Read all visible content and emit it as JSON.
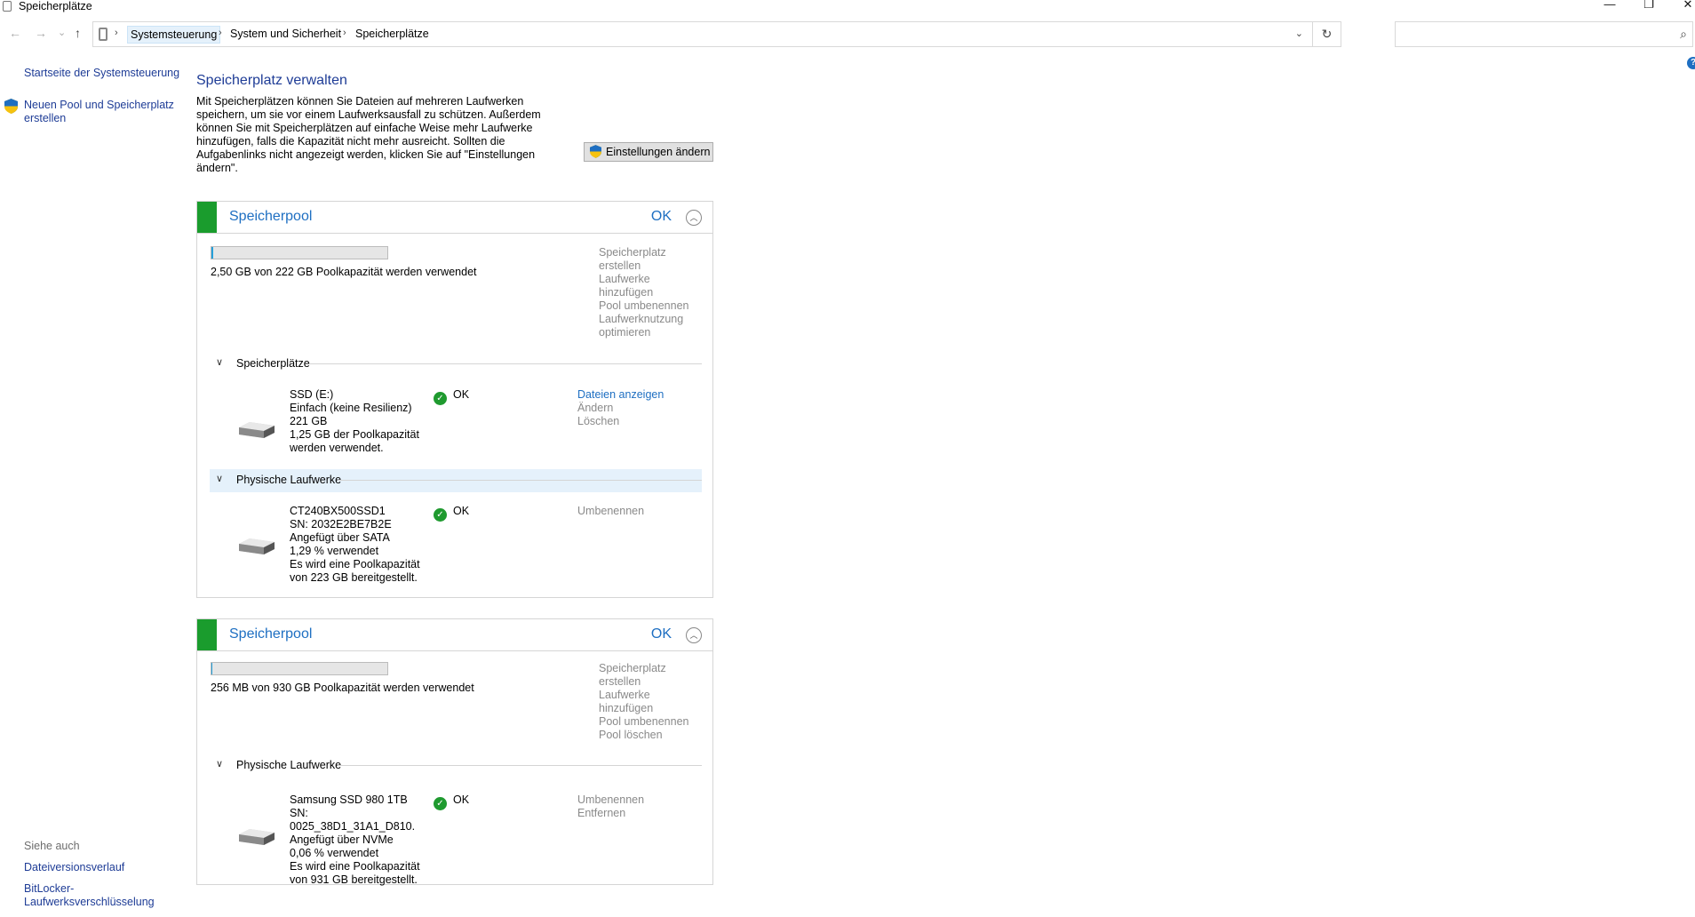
{
  "window": {
    "title": "Speicherplätze",
    "minimize": "—",
    "restore": "❐",
    "close": "✕"
  },
  "nav": {
    "back": "←",
    "forward": "→",
    "recent": "⌄",
    "up": "↑"
  },
  "address": {
    "crumbs": [
      "Systemsteuerung",
      "System und Sicherheit",
      "Speicherplätze"
    ],
    "separator": "›",
    "dropdown": "⌄",
    "refresh": "↻"
  },
  "search": {
    "placeholder": "",
    "icon": "⌕"
  },
  "help": "?",
  "sidebar": {
    "links": [
      "Startseite der Systemsteuerung",
      "Neuen Pool und Speicherplatz erstellen"
    ],
    "see_also_title": "Siehe auch",
    "see_also": [
      "Dateiversionsverlauf",
      "BitLocker-Laufwerksverschlüsselung"
    ]
  },
  "main": {
    "heading": "Speicherplatz verwalten",
    "intro": "Mit Speicherplätzen können Sie Dateien auf mehreren Laufwerken speichern, um sie vor einem Laufwerksausfall zu schützen. Außerdem können Sie mit Speicherplätzen auf einfache Weise mehr Laufwerke hinzufügen, falls die Kapazität nicht mehr ausreicht. Sollten die Aufgabenlinks nicht angezeigt werden, klicken Sie auf \"Einstellungen ändern\".",
    "settings_button": "Einstellungen ändern"
  },
  "pools": [
    {
      "name": "Speicherpool",
      "status": "OK",
      "usage_fraction": 0.011,
      "usage_text": "2,50 GB von 222 GB Poolkapazität werden verwendet",
      "actions": [
        "Speicherplatz erstellen",
        "Laufwerke hinzufügen",
        "Pool umbenennen",
        "Laufwerknutzung optimieren"
      ],
      "spaces_title": "Speicherplätze",
      "spaces": [
        {
          "lines": [
            "SSD (E:)",
            "Einfach (keine Resilienz)",
            "221 GB",
            "1,25 GB der Poolkapazität werden verwendet."
          ],
          "status": "OK",
          "actions": [
            "Dateien anzeigen",
            "Ändern",
            "Löschen"
          ]
        }
      ],
      "drives_title": "Physische Laufwerke",
      "drives": [
        {
          "lines": [
            "CT240BX500SSD1",
            "SN: 2032E2BE7B2E",
            "Angefügt über SATA",
            "1,29 % verwendet",
            "Es wird eine Poolkapazität von 223 GB bereitgestellt."
          ],
          "status": "OK",
          "actions": [
            "Umbenennen"
          ]
        }
      ]
    },
    {
      "name": "Speicherpool",
      "status": "OK",
      "usage_fraction": 0.0003,
      "usage_text": "256 MB von 930 GB Poolkapazität werden verwendet",
      "actions": [
        "Speicherplatz erstellen",
        "Laufwerke hinzufügen",
        "Pool umbenennen",
        "Pool löschen"
      ],
      "drives_title": "Physische Laufwerke",
      "drives": [
        {
          "lines": [
            "Samsung SSD 980 1TB",
            "SN: 0025_38D1_31A1_D810.",
            "Angefügt über NVMe",
            "0,06 % verwendet",
            "Es wird eine Poolkapazität von 931 GB bereitgestellt."
          ],
          "status": "OK",
          "actions": [
            "Umbenennen",
            "Entfernen"
          ]
        }
      ]
    }
  ]
}
